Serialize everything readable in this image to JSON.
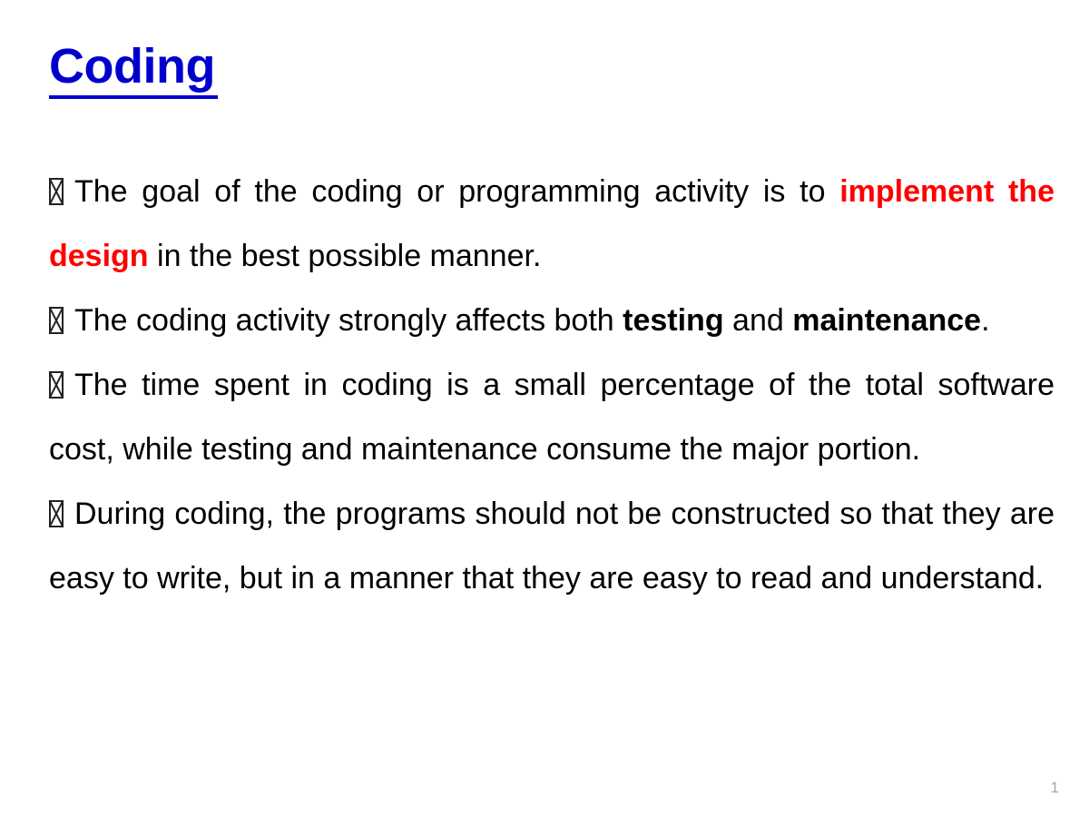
{
  "slide": {
    "title": "Coding",
    "title_color": "#0000CC",
    "background_color": "#FFFFFF",
    "page_number": "1",
    "page_number_color": "#A6A6A6",
    "bullet_glyph": "notdef-box",
    "bullets": [
      {
        "id": "bullet-goal",
        "segments": [
          {
            "text": "The goal of the coding or programming activity is to ",
            "style": "regular"
          },
          {
            "text": "implement the design",
            "style": "bold-red",
            "color": "#FF0000"
          },
          {
            "text": " in the best possible manner.",
            "style": "regular"
          }
        ]
      },
      {
        "id": "bullet-affects",
        "segments": [
          {
            "text": "The coding activity strongly affects both ",
            "style": "regular"
          },
          {
            "text": "testing",
            "style": "bold"
          },
          {
            "text": " and ",
            "style": "regular"
          },
          {
            "text": "maintenance",
            "style": "bold"
          },
          {
            "text": ".",
            "style": "regular"
          }
        ]
      },
      {
        "id": "bullet-time",
        "segments": [
          {
            "text": "The time spent in coding is a small percentage of the total software cost, while testing and maintenance consume the major portion.",
            "style": "regular"
          }
        ]
      },
      {
        "id": "bullet-readable",
        "segments": [
          {
            "text": "During coding, the programs should not be constructed so that they are easy to write, but in a manner that they are easy to read and understand.",
            "style": "regular"
          }
        ]
      }
    ]
  }
}
